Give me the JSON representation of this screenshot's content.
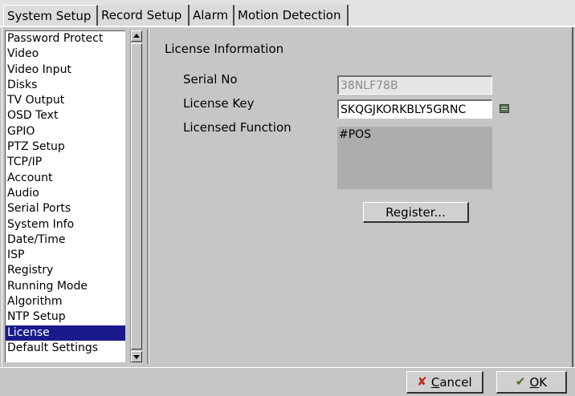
{
  "tabs": [
    {
      "label": "System Setup",
      "active": true
    },
    {
      "label": "Record Setup",
      "active": false
    },
    {
      "label": "Alarm",
      "active": false
    },
    {
      "label": "Motion Detection",
      "active": false
    }
  ],
  "sidebar": {
    "items": [
      "Password Protect",
      "Video",
      "Video Input",
      "Disks",
      "TV Output",
      "OSD Text",
      "GPIO",
      "PTZ Setup",
      "TCP/IP",
      "Account",
      "Audio",
      "Serial Ports",
      "System Info",
      "Date/Time",
      "ISP",
      "Registry",
      "Running Mode",
      "Algorithm",
      "NTP Setup",
      "License",
      "Default Settings"
    ],
    "selected": "License"
  },
  "license": {
    "title": "License Information",
    "serial_label": "Serial No",
    "serial_value": "38NLF78B",
    "key_label": "License Key",
    "key_value": "SKQGJKORKBLY5GRNC",
    "function_label": "Licensed Function",
    "function_value": "#POS",
    "register_label": "Register..."
  },
  "footer": {
    "cancel_prefix": "C",
    "cancel_rest": "ancel",
    "ok_prefix": "O",
    "ok_rest": "K"
  },
  "icons": {
    "keyboard": "keyboard-icon",
    "cancel": "cancel-x-icon",
    "ok": "ok-check-icon"
  }
}
